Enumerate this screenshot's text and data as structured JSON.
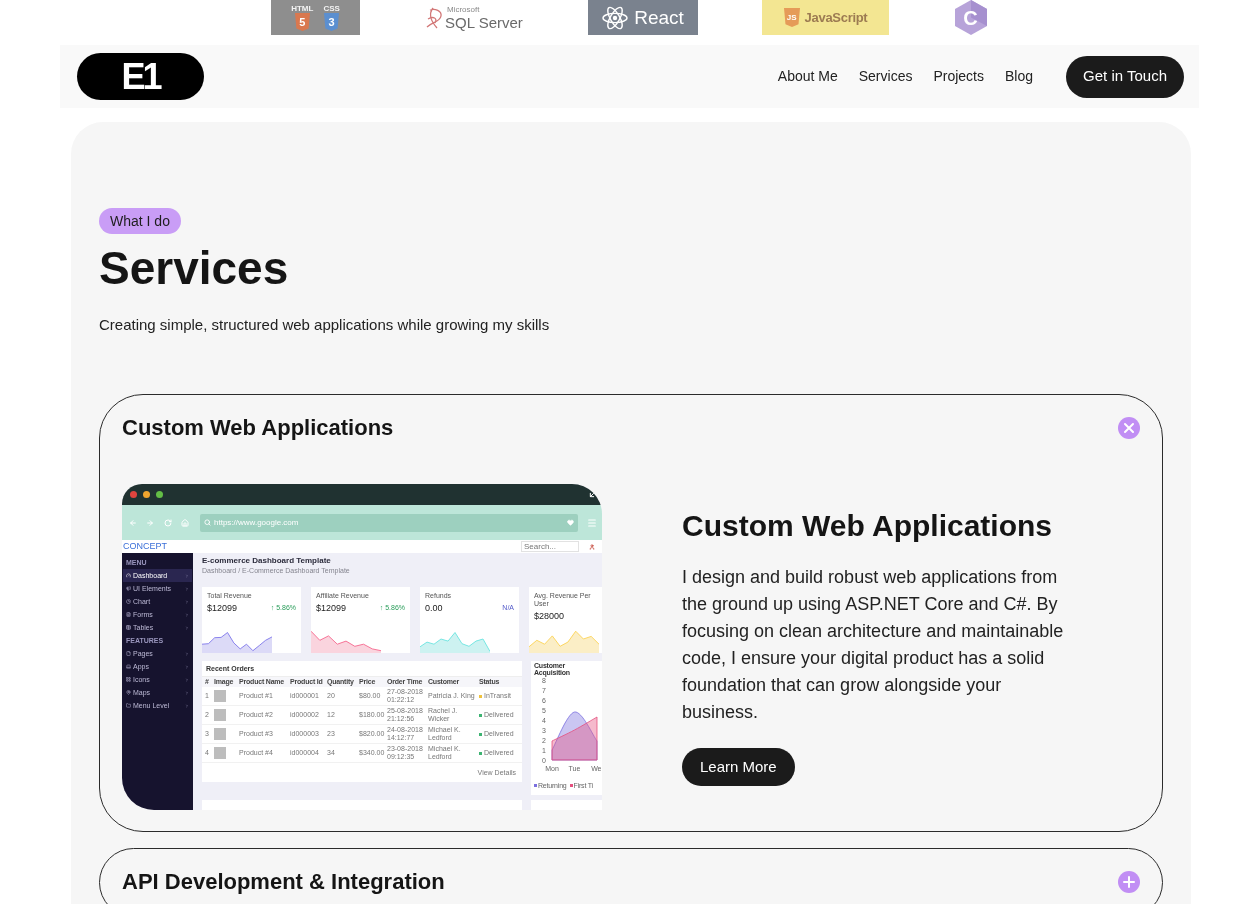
{
  "tech_logos": [
    {
      "kind": "html-css",
      "labels": [
        "HTML",
        "CSS"
      ],
      "marks": [
        "5",
        "3"
      ]
    },
    {
      "kind": "sql-server",
      "brand": "Microsoft",
      "name": "SQL Server"
    },
    {
      "kind": "react",
      "name": "React"
    },
    {
      "kind": "javascript",
      "mark": "JS",
      "name": "JavaScript"
    },
    {
      "kind": "csharp",
      "mark": "C"
    }
  ],
  "nav": {
    "logo": "E1",
    "links": [
      "About Me",
      "Services",
      "Projects",
      "Blog"
    ],
    "cta": "Get in Touch"
  },
  "section": {
    "badge": "What I do",
    "title": "Services",
    "subtitle": "Creating simple, structured web applications while growing my skills"
  },
  "services": [
    {
      "title": "Custom Web Applications",
      "expanded": true,
      "heading": "Custom Web Applications",
      "description": "I design and build robust web applications from the ground up using ASP.NET Core and C#. By focusing on clean architecture and maintainable code, I ensure your digital product has a solid foundation that can grow alongside your business.",
      "button": "Learn More",
      "preview": {
        "address": "https://www.google.com",
        "brand": "CONCEPT",
        "search_placeholder": "Search...",
        "menu": [
          {
            "kind": "heading",
            "label": "MENU"
          },
          {
            "kind": "item",
            "label": "Dashboard",
            "selected": true
          },
          {
            "kind": "item",
            "label": "UI Elements",
            "selected": false
          },
          {
            "kind": "item",
            "label": "Chart",
            "selected": false
          },
          {
            "kind": "item",
            "label": "Forms",
            "selected": false
          },
          {
            "kind": "item",
            "label": "Tables",
            "selected": false
          },
          {
            "kind": "heading",
            "label": "FEATURES"
          },
          {
            "kind": "item",
            "label": "Pages",
            "selected": false
          },
          {
            "kind": "item",
            "label": "Apps",
            "selected": false
          },
          {
            "kind": "item",
            "label": "Icons",
            "selected": false
          },
          {
            "kind": "item",
            "label": "Maps",
            "selected": false
          },
          {
            "kind": "item",
            "label": "Menu Level",
            "selected": false
          }
        ],
        "page_title": "E-commerce Dashboard Template",
        "breadcrumb": "Dashboard / E-Commerce Dashboard Template",
        "kpis": [
          {
            "kind": "gain",
            "label": "Total Revenue",
            "value": "$12099",
            "change": "↑ 5.86%",
            "color": "#dcdaf7"
          },
          {
            "kind": "gain",
            "label": "Affiliate Revenue",
            "value": "$12099",
            "change": "↑ 5.86%",
            "color": "#fad4de"
          },
          {
            "kind": "neutral",
            "label": "Refunds",
            "value": "0.00",
            "change": "N/A",
            "color": "#cdf2f1"
          },
          {
            "kind": "plain",
            "label": "Avg. Revenue Per User",
            "value": "$28000",
            "color": "#fbeec6"
          }
        ],
        "orders": {
          "title": "Recent Orders",
          "columns": [
            "#",
            "Image",
            "Product Name",
            "Product Id",
            "Quantity",
            "Price",
            "Order Time",
            "Customer",
            "Status"
          ],
          "rows": [
            {
              "number": "1",
              "product": "Product #1",
              "product_id": "id000001",
              "quantity": "20",
              "price": "$80.00",
              "order_time": "27-08-2018 01:22:12",
              "customer": "Patricia J. King",
              "status": "InTransit",
              "color": "#efc23c"
            },
            {
              "number": "2",
              "product": "Product #2",
              "product_id": "id000002",
              "quantity": "12",
              "price": "$180.00",
              "order_time": "25-08-2018 21:12:56",
              "customer": "Rachel J. Wicker",
              "status": "Delivered",
              "color": "#3cb371"
            },
            {
              "number": "3",
              "product": "Product #3",
              "product_id": "id000003",
              "quantity": "23",
              "price": "$820.00",
              "order_time": "24-08-2018 14:12:77",
              "customer": "Michael K. Ledford",
              "status": "Delivered",
              "color": "#3cb371"
            },
            {
              "number": "4",
              "product": "Product #4",
              "product_id": "id000004",
              "quantity": "34",
              "price": "$340.00",
              "order_time": "23-08-2018 09:12:35",
              "customer": "Michael K. Ledford",
              "status": "Delivered",
              "color": "#3cb371"
            }
          ],
          "link": "View Details"
        },
        "acquisition": {
          "chart_data": {
            "type": "area",
            "title": "Customer Acquisition",
            "categories": [
              "Mon",
              "Tue",
              "We"
            ],
            "series": [
              {
                "name": "Returning",
                "color": "#7b70df",
                "values": [
                  1,
                  4.8,
                  1.9
                ]
              },
              {
                "name": "First Ti",
                "color": "#e5507f",
                "values": [
                  1.9,
                  3,
                  4.3
                ]
              }
            ],
            "ylim": [
              0,
              8
            ],
            "yticks": [
              0,
              1,
              2,
              3,
              4,
              5,
              6,
              7,
              8
            ],
            "legend": "bottom"
          }
        }
      }
    },
    {
      "title": "API Development & Integration",
      "expanded": false
    }
  ]
}
